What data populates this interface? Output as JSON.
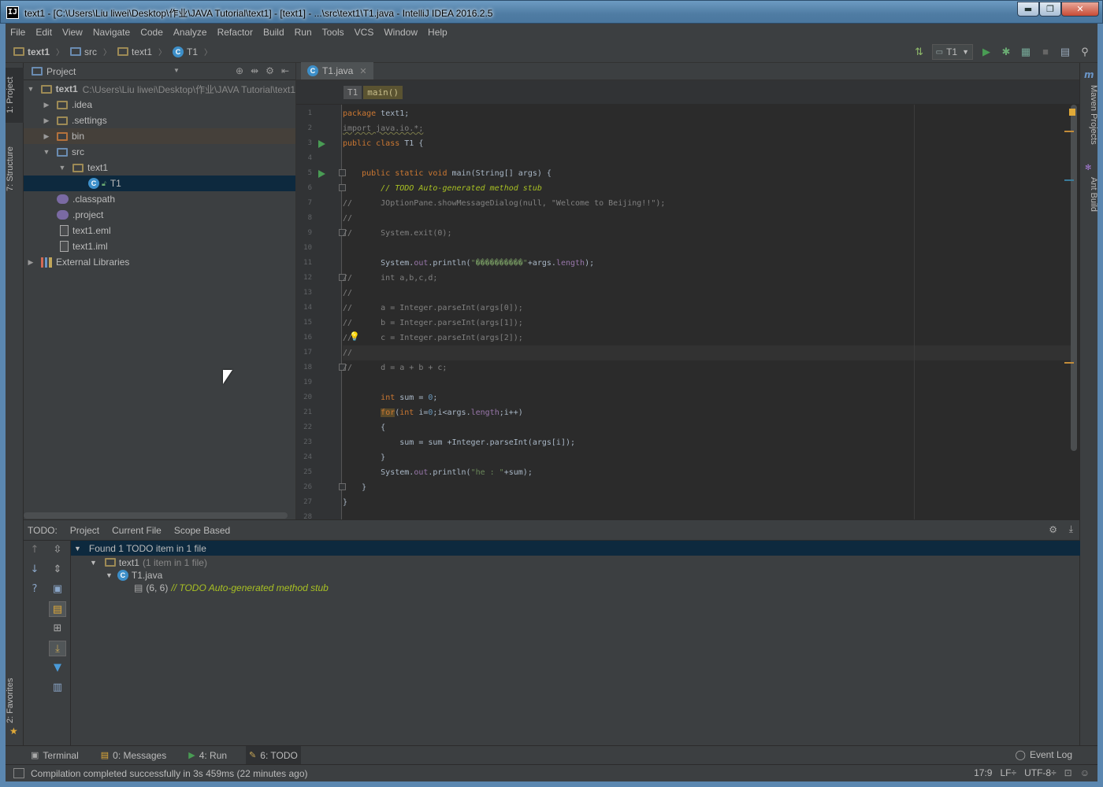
{
  "window": {
    "title": "text1 - [C:\\Users\\Liu liwei\\Desktop\\作业\\JAVA Tutorial\\text1] - [text1] - ...\\src\\text1\\T1.java - IntelliJ IDEA 2016.2.5",
    "app_icon": "IJ",
    "min_glyph": "▬",
    "max_glyph": "❐",
    "close_glyph": "✕"
  },
  "menu": [
    "File",
    "Edit",
    "View",
    "Navigate",
    "Code",
    "Analyze",
    "Refactor",
    "Build",
    "Run",
    "Tools",
    "VCS",
    "Window",
    "Help"
  ],
  "navbar": {
    "crumbs": [
      "text1",
      "src",
      "text1",
      "T1"
    ],
    "run_config": "T1"
  },
  "left_stripe": {
    "project": "1: Project",
    "structure": "7: Structure",
    "favorites": "2: Favorites"
  },
  "right_stripe": {
    "maven": "Maven Projects",
    "ant": "Ant Build"
  },
  "project_panel": {
    "header": "Project",
    "tree": [
      {
        "label": "text1",
        "path": "C:\\Users\\Liu liwei\\Desktop\\作业\\JAVA Tutorial\\text1",
        "icon": "module-folder-icon"
      },
      {
        "label": ".idea",
        "icon": "folder-icon"
      },
      {
        "label": ".settings",
        "icon": "folder-icon"
      },
      {
        "label": "bin",
        "icon": "excluded-folder-icon"
      },
      {
        "label": "src",
        "icon": "source-folder-icon"
      },
      {
        "label": "text1",
        "icon": "package-icon"
      },
      {
        "label": "T1",
        "icon": "class-icon"
      },
      {
        "label": ".classpath",
        "icon": "classpath-file-icon"
      },
      {
        "label": ".project",
        "icon": "project-file-icon"
      },
      {
        "label": "text1.eml",
        "icon": "file-icon"
      },
      {
        "label": "text1.iml",
        "icon": "iml-file-icon"
      },
      {
        "label": "External Libraries",
        "icon": "libraries-icon"
      }
    ]
  },
  "editor": {
    "tab": "T1.java",
    "breadcrumb": [
      "T1",
      "main()"
    ],
    "line_numbers": [
      "1",
      "2",
      "3",
      "4",
      "5",
      "6",
      "7",
      "8",
      "9",
      "10",
      "11",
      "12",
      "13",
      "14",
      "15",
      "16",
      "17",
      "18",
      "19",
      "20",
      "21",
      "22",
      "23",
      "24",
      "25",
      "26",
      "27",
      "28"
    ],
    "code": {
      "l1_kw": "package",
      "l1_rest": " text1;",
      "l2": "import java.io.*;",
      "l3_kw": "public class",
      "l3_rest": " T1 {",
      "l5_indent": "    ",
      "l5_kw": "public static void",
      "l5_rest": " main(String[] args) {",
      "l6_indent": "        ",
      "l6_todo": "// TODO Auto-generated method stub",
      "l7": "//      JOptionPane.showMessageDialog(null, \"Welcome to Beijing!!\");",
      "l8": "//",
      "l9": "//      System.exit(0);",
      "l11_a": "        System.",
      "l11_fld": "out",
      "l11_b": ".println(",
      "l11_str": "\"����������\"",
      "l11_c": "+args.",
      "l11_fld2": "length",
      "l11_d": ");",
      "l12": "//      int a,b,c,d;",
      "l13": "//",
      "l14": "//      a = Integer.parseInt(args[0]);",
      "l15": "//      b = Integer.parseInt(args[1]);",
      "l16": "//      c = Integer.parseInt(args[2]);",
      "l17": "//",
      "l18": "//      d = a + b + c;",
      "l20_indent": "        ",
      "l20_kw": "int",
      "l20_rest": " sum = ",
      "l20_num": "0",
      "l20_end": ";",
      "l21_indent": "        ",
      "l21_kw": "for",
      "l21_a": "(",
      "l21_kw2": "int",
      "l21_b": " i=",
      "l21_num": "0",
      "l21_c": ";i<args.",
      "l21_fld": "length",
      "l21_d": ";i++)",
      "l22": "        {",
      "l23": "            sum = sum +Integer.parseInt(args[i]);",
      "l24": "        }",
      "l25_a": "        System.",
      "l25_fld": "out",
      "l25_b": ".println(",
      "l25_str": "\"he : \"",
      "l25_c": "+sum);",
      "l26": "    }",
      "l27": "}"
    },
    "current_line": 17,
    "bulb_icon": "💡"
  },
  "todo_panel": {
    "tabs": [
      "TODO:",
      "Project",
      "Current File",
      "Scope Based"
    ],
    "summary": "Found 1 TODO item in 1 file",
    "module": "text1",
    "module_count": "(1 item in 1 file)",
    "file": "T1.java",
    "position": "(6, 6)",
    "item_text": "// TODO Auto-generated method stub"
  },
  "bottom_tabs": [
    {
      "label": "Terminal",
      "icon": "terminal-icon"
    },
    {
      "label": "0: Messages",
      "icon": "messages-icon"
    },
    {
      "label": "4: Run",
      "icon": "run-icon"
    },
    {
      "label": "6: TODO",
      "icon": "todo-icon"
    }
  ],
  "event_log": "Event Log",
  "status": {
    "message": "Compilation completed successfully in 3s 459ms (22 minutes ago)",
    "position": "17:9",
    "line_sep": "LF÷",
    "encoding": "UTF-8÷"
  },
  "colors": {
    "keyword": "#cc7832",
    "comment": "#808080",
    "todo": "#a8c023",
    "string": "#6a8759",
    "selection": "#0d293e",
    "panel": "#3c3f41",
    "editor_bg": "#2b2b2b"
  }
}
